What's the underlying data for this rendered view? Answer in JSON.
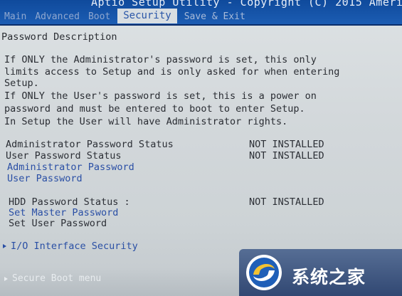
{
  "app": {
    "title": "Aptio Setup Utility - Copyright (C) 2015 Americ"
  },
  "tabs": [
    {
      "label": "Main",
      "active": false
    },
    {
      "label": "Advanced",
      "active": false
    },
    {
      "label": "Boot",
      "active": false
    },
    {
      "label": "Security",
      "active": true
    },
    {
      "label": "Save & Exit",
      "active": false
    }
  ],
  "description": {
    "heading": "Password Description",
    "lines": [
      "If ONLY the Administrator's password is set, this only",
      "limits access to Setup and is only asked for when entering",
      "Setup.",
      "If ONLY the User's password is set, this is a power on",
      "password and must be entered to boot to enter Setup.",
      "In Setup the User will have Administrator rights."
    ]
  },
  "settings": {
    "admin_status_label": "Administrator Password Status",
    "admin_status_value": "NOT INSTALLED",
    "user_status_label": "User Password Status",
    "user_status_value": "NOT INSTALLED",
    "admin_password_link": "Administrator Password",
    "user_password_link": "User Password",
    "hdd_status_label": "HDD Password Status   :",
    "hdd_status_value": "NOT INSTALLED",
    "set_master_password": "Set Master Password",
    "set_user_password": "Set User Password",
    "io_interface_security": "I/O Interface Security",
    "secure_boot_menu": "Secure Boot menu"
  },
  "watermark": {
    "text": "系统之家"
  },
  "colors": {
    "header_blue": "#1c5db3",
    "link_blue": "#2a4fa5",
    "text_dark": "#2c2f36",
    "screen_bg": "#d3d8db"
  }
}
